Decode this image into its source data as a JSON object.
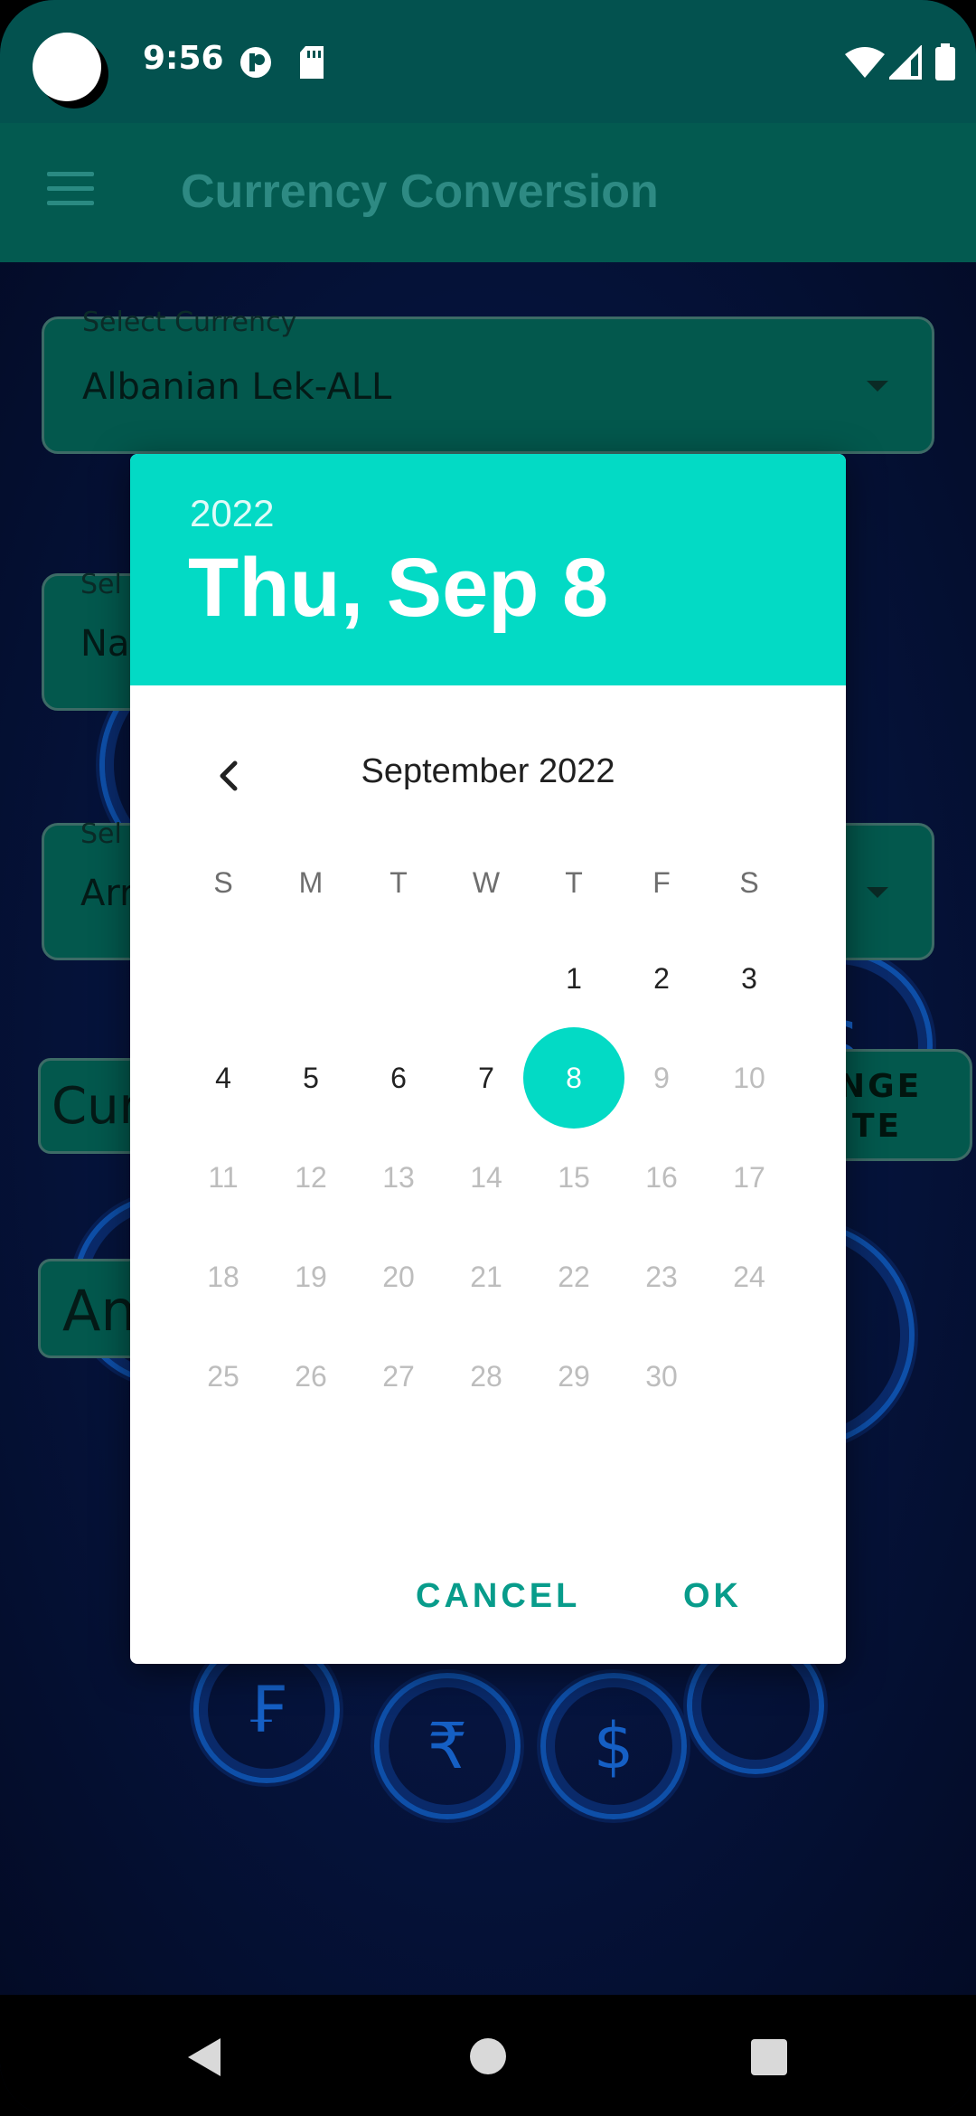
{
  "status_bar": {
    "time": "9:56"
  },
  "toolbar": {
    "title": "Currency Conversion"
  },
  "form": {
    "select_currency_hint": "Select Currency",
    "select_currency_value": "Albanian Lek-ALL",
    "field2_hint": "Sel",
    "field2_value": "Na",
    "field3_hint": "Sel",
    "field3_value": "Arr",
    "current_label": "Cur",
    "exchange_button": [
      "NGE",
      "TE"
    ],
    "amount_label": "An"
  },
  "dialog": {
    "year": "2022",
    "selected_date": "Thu, Sep 8",
    "month_label": "September 2022",
    "weekdays": [
      "S",
      "M",
      "T",
      "W",
      "T",
      "F",
      "S"
    ],
    "first_weekday_index": 4,
    "days_in_month": 30,
    "selected_day": 8,
    "last_enabled_day": 8,
    "cancel_label": "CANCEL",
    "ok_label": "OK"
  },
  "colors": {
    "accent": "#03dac5",
    "status_bar": "#03524f",
    "toolbar": "#035a50",
    "button_text": "#089c8b"
  },
  "icons": {
    "prev_month": "chevron-left-icon",
    "menu": "hamburger-menu-icon",
    "nav_back": "triangle-back-icon",
    "nav_home": "circle-home-icon",
    "nav_recents": "square-recents-icon"
  }
}
